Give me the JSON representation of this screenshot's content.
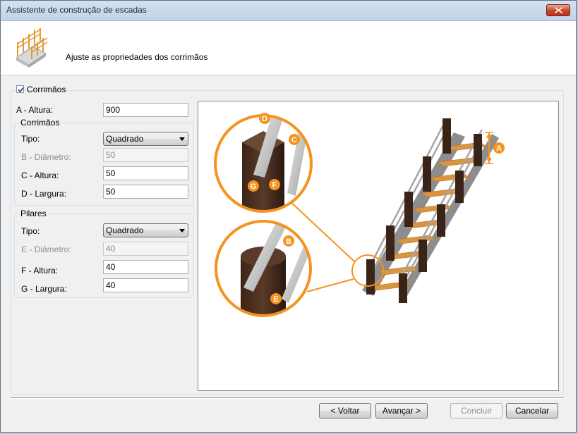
{
  "window": {
    "title": "Assistente de construção de escadas"
  },
  "header": {
    "text": "Ajuste as propriedades dos corrimãos"
  },
  "handrails": {
    "checkbox_label": "Corrimãos",
    "checked": true,
    "height_label": "A - Altura:",
    "height_value": "900"
  },
  "rails": {
    "group_title": "Corrimãos",
    "type_label": "Tipo:",
    "type_value": "Quadrado",
    "diameter_label": "B - Diâmetro:",
    "diameter_value": "50",
    "height_label": "C - Altura:",
    "height_value": "50",
    "width_label": "D - Largura:",
    "width_value": "50"
  },
  "posts": {
    "group_title": "Pilares",
    "type_label": "Tipo:",
    "type_value": "Quadrado",
    "diameter_label": "E - Diâmetro:",
    "diameter_value": "40",
    "height_label": "F - Altura:",
    "height_value": "40",
    "width_label": "G - Largura:",
    "width_value": "40"
  },
  "preview": {
    "badges": [
      "A",
      "B",
      "C",
      "D",
      "E",
      "F",
      "G"
    ],
    "accent_color": "#f5931e"
  },
  "buttons": {
    "back": "< Voltar",
    "next": "Avançar >",
    "finish": "Concluir",
    "cancel": "Cancelar"
  }
}
